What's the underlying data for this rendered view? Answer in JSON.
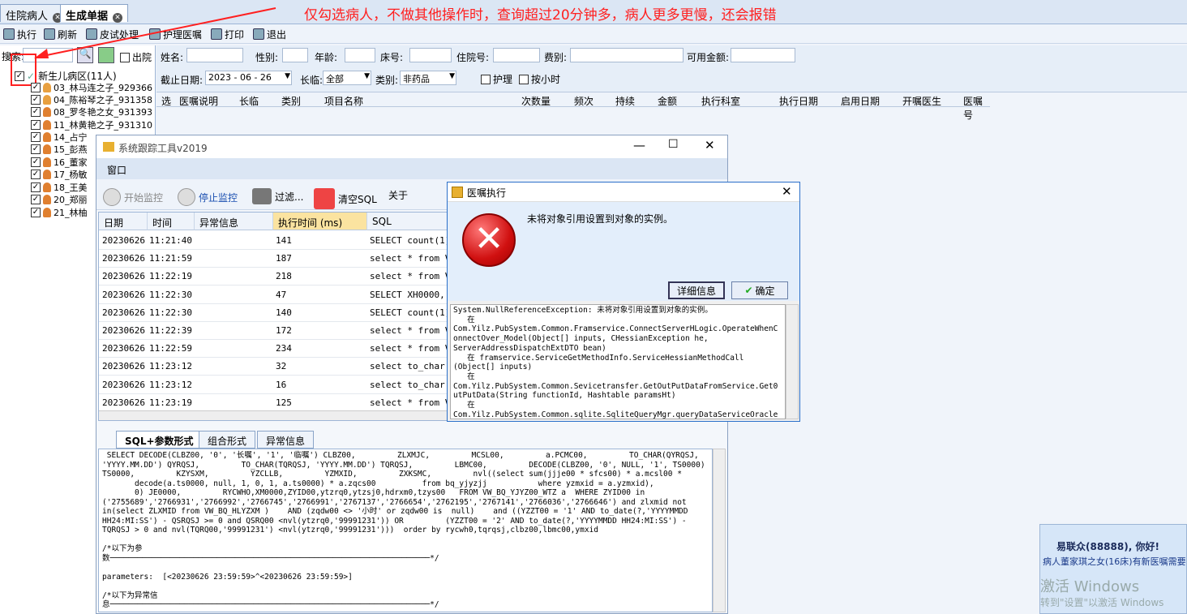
{
  "tabs": [
    {
      "label": "住院病人",
      "active": false
    },
    {
      "label": "生成单据",
      "active": true
    }
  ],
  "annotation": "仅勾选病人，不做其他操作时，查询超过20分钟多，病人更多更慢，还会报错",
  "toolbar": {
    "items": [
      {
        "label": "执行",
        "icon": "gear-icon"
      },
      {
        "label": "刷新",
        "icon": "refresh-icon"
      },
      {
        "label": "皮试处理",
        "icon": "syringe-icon"
      },
      {
        "label": "护理医嘱",
        "icon": "nursing-icon"
      },
      {
        "label": "打印",
        "icon": "printer-icon"
      },
      {
        "label": "退出",
        "icon": "exit-icon"
      }
    ]
  },
  "left": {
    "search_label": "搜索:",
    "discharged_label": "出院",
    "ward": "新生儿病区(11人)",
    "patients": [
      "03_林马连之子_929366",
      "04_陈裕琴之子_931358",
      "08_罗冬艳之女_931393",
      "11_林黄艳之子_931310",
      "14_占宁",
      "15_彭燕",
      "16_董家",
      "17_杨敏",
      "18_王美",
      "20_郑丽",
      "21_林柚"
    ]
  },
  "filters": {
    "name_label": "姓名:",
    "gender_label": "性别:",
    "age_label": "年龄:",
    "bed_label": "床号:",
    "inpatient_label": "住院号:",
    "fee_label": "费别:",
    "balance_label": "可用金额:",
    "deadline_label": "截止日期:",
    "deadline_value": "2023 - 06 - 26",
    "duration_label": "长临:",
    "duration_value": "全部",
    "category_label": "类别:",
    "category_value": "非药品",
    "nursing_label": "护理",
    "hourly_label": "按小时"
  },
  "grid_headers": [
    "选",
    "医嘱说明",
    "长临",
    "类别",
    "项目名称",
    "次数量",
    "频次",
    "持续",
    "金额",
    "执行科室",
    "执行日期",
    "启用日期",
    "开嘱医生",
    "医嘱号"
  ],
  "trace": {
    "title": "系统跟踪工具v2019",
    "menu": "窗口",
    "tools": [
      "开始监控",
      "停止监控",
      "过滤...",
      "清空SQL",
      "关于"
    ],
    "columns": [
      "日期",
      "时间",
      "异常信息",
      "执行时间 (ms)",
      "SQL"
    ],
    "rows": [
      {
        "date": "20230626",
        "time": "11:21:40",
        "err": "",
        "ms": "141",
        "sql": " SELECT count(1)"
      },
      {
        "date": "20230626",
        "time": "11:21:59",
        "err": "",
        "ms": "187",
        "sql": "select * from VW_"
      },
      {
        "date": "20230626",
        "time": "11:22:19",
        "err": "",
        "ms": "218",
        "sql": "select * from VW_"
      },
      {
        "date": "20230626",
        "time": "11:22:30",
        "err": "",
        "ms": "47",
        "sql": " SELECT XH0000, X"
      },
      {
        "date": "20230626",
        "time": "11:22:30",
        "err": "",
        "ms": "140",
        "sql": " SELECT count(1)"
      },
      {
        "date": "20230626",
        "time": "11:22:39",
        "err": "",
        "ms": "172",
        "sql": "select * from VW_"
      },
      {
        "date": "20230626",
        "time": "11:22:59",
        "err": "",
        "ms": "234",
        "sql": "select * from VW_"
      },
      {
        "date": "20230626",
        "time": "11:23:12",
        "err": "",
        "ms": "32",
        "sql": "select to_char(XH"
      },
      {
        "date": "20230626",
        "time": "11:23:12",
        "err": "",
        "ms": "16",
        "sql": "select to_char(a."
      },
      {
        "date": "20230626",
        "time": "11:23:19",
        "err": "",
        "ms": "125",
        "sql": "select * from VW_"
      }
    ],
    "sql_tabs": [
      "SQL+参数形式",
      "组合形式",
      "异常信息"
    ],
    "sql_text": " SELECT DECODE(CLBZ00, '0', '长嘱', '1', '临嘱') CLBZ00,         ZLXMJC,         MCSL00,         a.PCMC00,         TO_CHAR(QYRQSJ,\n'YYYY.MM.DD') QYRQSJ,         TO_CHAR(TQRQSJ, 'YYYY.MM.DD') TQRQSJ,         LBMC00,         DECODE(CLBZ00, '0', NULL, '1', TS0000)\nTS0000,         KZYSXM,         YZCLLB,         YZMXID,         ZXKSMC,         nvl((select sum(jjje00 * sfcs00) * a.mcsl00 *\n       decode(a.ts0000, null, 1, 0, 1, a.ts0000) * a.zqcs00          from bq_yjyzjj           where yzmxid = a.yzmxid),\n       0) JE0000,         RYCWHO,XM0000,ZYID00,ytzrq0,ytzsj0,hdrxm0,tzys00   FROM VW_BQ_YJYZ00_WTZ a  WHERE ZYID00 in\n('2755689','2766931','2766992','2766745','2766991','2767137','2766654','2762195','2767141','2766036','2766646') and zlxmid not\nin(select ZLXMID from VW_BQ_HLYZXM )    AND (zqdw00 <> '小时' or zqdw00 is  null)    and ((YZZT00 = '1' AND to_date(?,'YYYYMMDD\nHH24:MI:SS') - QSRQSJ >= 0 and QSRQ00 <nvl(ytzrq0,'99991231')) OR         (YZZT00 = '2' AND to_date(?,'YYYYMMDD HH24:MI:SS') -\nTQRQSJ > 0 and nvl(TQRQ00,'99991231') <nvl(ytzrq0,'99991231')))  order by rycwh0,tqrqsj,clbz00,lbmc00,ymxid\n\n/*以下为参\n数─────────────────────────────────────────────────────────────────────*/\n\nparameters:  [<20230626 23:59:59>^<20230626 23:59:59>]\n\n/*以下为异常信\n息─────────────────────────────────────────────────────────────────────*/"
  },
  "dialog": {
    "title": "医嘱执行",
    "message": "未将对象引用设置到对象的实例。",
    "detail_button": "详细信息",
    "ok_button": "确定",
    "trace": "System.NullReferenceException: 未将对象引用设置到对象的实例。\n   在\nCom.Yilz.PubSystem.Common.Framservice.ConnectServerHLogic.OperateWhenC\nonnectOver_Model(Object[] inputs, CHessianException he,\nServerAddressDispatchExtDTO bean)\n   在 framservice.ServiceGetMethodInfo.ServiceHessianMethodCall\n(Object[] inputs)\n   在\nCom.Yilz.PubSystem.Common.Sevicetransfer.GetOutPutDataFromService.Get0\nutPutData(String functionId, Hashtable paramsHt)\n   在\nCom.Yilz.PubSystem.Common.sqlite.SqliteQueryMgr.queryDataServiceOracle"
  },
  "notice": {
    "greeting": "易联众(88888), 你好!",
    "message": "病人董家琪之女(16床)有新医嘱需要",
    "watermark1": "激活 Windows",
    "watermark2": "转到\"设置\"以激活 Windows"
  }
}
